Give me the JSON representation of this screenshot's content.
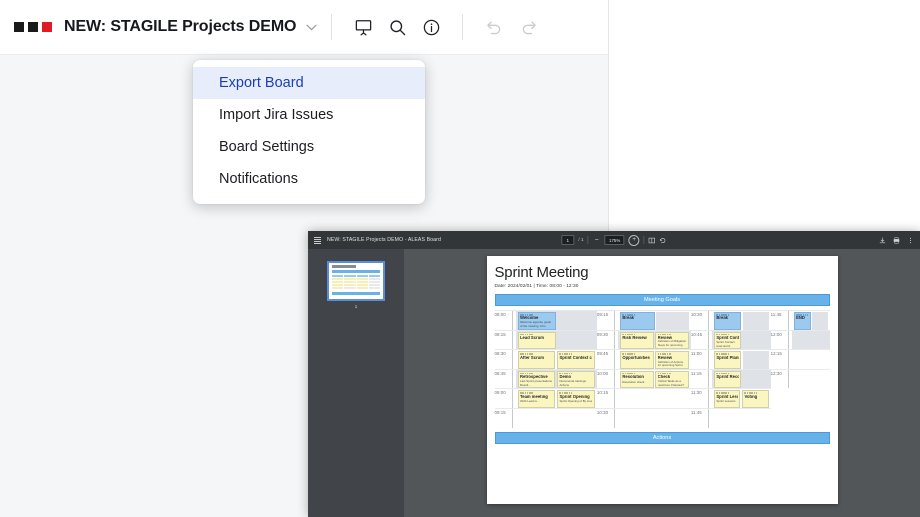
{
  "app": {
    "logo_squares": [
      "#1a1a1a",
      "#1a1a1a",
      "#e01b24"
    ],
    "board_title": "NEW: STAGILE Projects DEMO",
    "caret": "⌄",
    "toolbar_icons": [
      {
        "name": "present-icon",
        "label": "Present"
      },
      {
        "name": "search-icon",
        "label": "Search"
      },
      {
        "name": "info-icon",
        "label": "Info"
      },
      {
        "name": "undo-icon",
        "label": "Undo"
      },
      {
        "name": "redo-icon",
        "label": "Redo"
      }
    ]
  },
  "menu": {
    "items": [
      {
        "label": "Export Board",
        "active": true
      },
      {
        "label": "Import Jira Issues",
        "active": false
      },
      {
        "label": "Board Settings",
        "active": false
      },
      {
        "label": "Notifications",
        "active": false
      }
    ],
    "highlight_color": "#e8edfb",
    "highlight_text_color": "#1a3fb5"
  },
  "pdf_viewer": {
    "doc_title": "NEW: STAGILE Projects DEMO - ALEAS Board",
    "page_current": "1",
    "page_total": "/ 1",
    "zoom_level": "175%",
    "zoom_out": "−",
    "zoom_in": "+",
    "thumbnail_label": "1",
    "right_icons": [
      {
        "name": "download-icon"
      },
      {
        "name": "print-icon"
      },
      {
        "name": "more-options-icon"
      }
    ],
    "center_icons": [
      {
        "name": "page-fit-icon"
      },
      {
        "name": "rotate-icon"
      }
    ]
  },
  "document": {
    "title": "Sprint Meeting",
    "subtitle": "Date: 2024/02/01 | Time: 08:00 - 12:30",
    "header_banner": "Meeting Goals",
    "footer_banner": "Actions",
    "banner_color": "#67b2e8",
    "columns": [
      {
        "times": [
          "08:00",
          "08:15",
          "08:30",
          "08:45",
          "09:00",
          "09:15"
        ],
        "rows": [
          {
            "shade": true,
            "cards": [
              {
                "title": "Welcome",
                "body": "Welcome agenda, goals of the meeting, intro",
                "meta": "08:00",
                "color": "blue"
              },
              {
                "title": "",
                "body": "",
                "color": "empty"
              }
            ]
          },
          {
            "shade": true,
            "cards": [
              {
                "title": "Lead Scrum",
                "body": "",
                "color": "yellow"
              },
              {
                "title": "",
                "body": "",
                "color": "empty"
              }
            ]
          },
          {
            "shade": false,
            "cards": [
              {
                "title": "After Scrum",
                "body": "",
                "color": "yellow"
              },
              {
                "title": "Sprint Context check",
                "body": "",
                "color": "yellow"
              }
            ]
          },
          {
            "shade": true,
            "cards": [
              {
                "title": "Retrospective",
                "body": "Last Sprint presentations Result...",
                "color": "yellow"
              },
              {
                "title": "Demo",
                "body": "Documenta trainings Actions",
                "color": "yellow"
              }
            ]
          },
          {
            "shade": false,
            "cards": [
              {
                "title": "Team meeting",
                "body": "2024 Lead re...",
                "color": "yellow"
              },
              {
                "title": "Sprint Opening",
                "body": "Sprint Opening of By Line",
                "color": "yellow"
              }
            ]
          }
        ]
      },
      {
        "times": [
          "09:15",
          "09:30",
          "09:45",
          "10:00",
          "10:15",
          "10:30"
        ],
        "rows": [
          {
            "shade": false,
            "cards": [
              {
                "title": "Break",
                "body": "",
                "color": "blue"
              },
              {
                "title": "",
                "body": "",
                "color": "empty"
              }
            ]
          },
          {
            "shade": true,
            "cards": [
              {
                "title": "Risk Review",
                "body": "",
                "color": "yellow"
              },
              {
                "title": "Review",
                "body": "Definition of Mitigation Steps for upcoming Sprint",
                "color": "yellow"
              }
            ]
          },
          {
            "shade": false,
            "cards": [
              {
                "title": "Opportunities Review",
                "body": "",
                "color": "yellow"
              },
              {
                "title": "Review",
                "body": "Definition of Actions for upcoming Sprint",
                "color": "yellow"
              }
            ]
          },
          {
            "shade": false,
            "cards": [
              {
                "title": "Resolution",
                "body": "Resolution check",
                "color": "yellow"
              },
              {
                "title": "Check",
                "body": "Critical Tasks as a result key Changes?",
                "color": "yellow"
              }
            ]
          },
          {
            "shade": false,
            "cards": []
          }
        ]
      },
      {
        "times": [
          "10:30",
          "10:45",
          "11:00",
          "11:15",
          "11:30",
          "11:45"
        ],
        "rows": [
          {
            "shade": false,
            "cards": [
              {
                "title": "Break",
                "body": "",
                "color": "blue"
              },
              {
                "title": "",
                "body": "",
                "color": "empty"
              }
            ]
          },
          {
            "shade": true,
            "cards": [
              {
                "title": "Sprint Contact",
                "body": "Sprint Contact level sprint",
                "color": "yellow"
              },
              {
                "title": "",
                "body": "",
                "color": "empty"
              }
            ]
          },
          {
            "shade": false,
            "cards": [
              {
                "title": "Sprint Planning",
                "body": "",
                "color": "yellow"
              },
              {
                "title": "",
                "body": "",
                "color": "empty"
              }
            ]
          },
          {
            "shade": true,
            "cards": [
              {
                "title": "Sprint Records",
                "body": "",
                "color": "yellow"
              },
              {
                "title": "",
                "body": "",
                "color": "empty"
              }
            ]
          },
          {
            "shade": false,
            "cards": [
              {
                "title": "Sprint Lessons",
                "body": "Sprint Lessons",
                "color": "yellow"
              },
              {
                "title": "Voting",
                "body": "",
                "color": "yellow"
              }
            ]
          }
        ]
      },
      {
        "times": [
          "11:45",
          "12:00",
          "12:15",
          "12:30"
        ],
        "rows": [
          {
            "shade": false,
            "cards": [
              {
                "title": "END",
                "body": "",
                "color": "blue"
              },
              {
                "title": "",
                "body": "",
                "color": "empty"
              }
            ]
          },
          {
            "shade": true,
            "cards": []
          },
          {
            "shade": false,
            "cards": []
          },
          {
            "shade": false,
            "cards": []
          }
        ]
      }
    ]
  }
}
